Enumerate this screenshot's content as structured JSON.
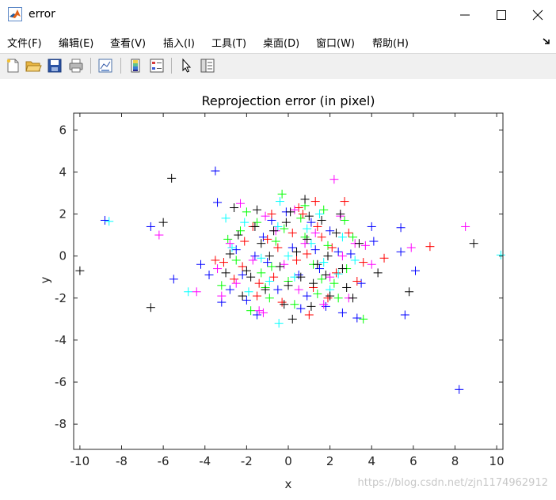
{
  "window": {
    "title": "error",
    "accent": "#0072bd"
  },
  "menu": {
    "items": [
      "文件(F)",
      "编辑(E)",
      "查看(V)",
      "插入(I)",
      "工具(T)",
      "桌面(D)",
      "窗口(W)",
      "帮助(H)"
    ]
  },
  "toolbar": {
    "buttons": [
      "new-figure-icon",
      "open-file-icon",
      "save-icon",
      "print-icon",
      "link-plot-icon",
      "colorbar-icon",
      "legend-icon",
      "pointer-icon",
      "property-inspector-icon"
    ]
  },
  "watermark": "https://blog.csdn.net/zjn1174962912",
  "chart_data": {
    "type": "scatter",
    "title": "Reprojection error (in pixel)",
    "xlabel": "x",
    "ylabel": "y",
    "xlim": [
      -10.3,
      10.3
    ],
    "ylim": [
      -9.2,
      6.8
    ],
    "xticks": [
      -10,
      -8,
      -6,
      -4,
      -2,
      0,
      2,
      4,
      6,
      8,
      10
    ],
    "yticks": [
      -8,
      -6,
      -4,
      -2,
      0,
      2,
      4,
      6
    ],
    "marker": "+",
    "grid": false,
    "colors": [
      "#0000ff",
      "#00ff00",
      "#ff0000",
      "#00ffff",
      "#ff00ff",
      "#000000"
    ],
    "series": [
      {
        "color": "#0000ff",
        "points": [
          [
            -8.8,
            1.7
          ],
          [
            -6.6,
            1.4
          ],
          [
            -3.5,
            4.05
          ],
          [
            -3.4,
            2.55
          ],
          [
            -5.5,
            -1.1
          ],
          [
            -4.2,
            -0.4
          ],
          [
            -3.2,
            -2.2
          ],
          [
            -2.0,
            -2.1
          ],
          [
            -1.5,
            -2.8
          ],
          [
            -0.5,
            -1.6
          ],
          [
            0.6,
            -2.5
          ],
          [
            1.8,
            -2.4
          ],
          [
            2.6,
            -2.7
          ],
          [
            3.3,
            -2.95
          ],
          [
            3.5,
            -1.3
          ],
          [
            4.0,
            1.4
          ],
          [
            4.1,
            0.7
          ],
          [
            5.4,
            1.35
          ],
          [
            5.4,
            0.2
          ],
          [
            6.1,
            -0.7
          ],
          [
            5.6,
            -2.8
          ],
          [
            8.2,
            -6.35
          ],
          [
            -2.5,
            0.3
          ],
          [
            -1.2,
            0.9
          ],
          [
            0.2,
            0.4
          ],
          [
            1.5,
            -0.6
          ],
          [
            2.4,
            0.2
          ],
          [
            -0.8,
            1.7
          ],
          [
            1.1,
            1.6
          ],
          [
            -2.2,
            -0.9
          ],
          [
            0.5,
            -0.9
          ],
          [
            2.0,
            1.2
          ],
          [
            -1.6,
            0.0
          ],
          [
            3.0,
            0.1
          ],
          [
            -3.8,
            -0.9
          ],
          [
            -0.1,
            2.1
          ],
          [
            1.3,
            0.3
          ],
          [
            -2.8,
            -1.6
          ],
          [
            0.9,
            -1.9
          ],
          [
            -1.0,
            -0.3
          ]
        ]
      },
      {
        "color": "#00ff00",
        "points": [
          [
            -2.0,
            2.1
          ],
          [
            -1.5,
            1.6
          ],
          [
            -0.3,
            2.95
          ],
          [
            0.8,
            2.4
          ],
          [
            1.7,
            2.2
          ],
          [
            2.7,
            1.7
          ],
          [
            -2.5,
            -0.2
          ],
          [
            -1.8,
            -2.6
          ],
          [
            -0.9,
            -2.0
          ],
          [
            0.3,
            -2.3
          ],
          [
            1.4,
            -1.8
          ],
          [
            2.2,
            -1.3
          ],
          [
            3.6,
            -3.0
          ],
          [
            -3.2,
            -1.4
          ],
          [
            -0.6,
            0.7
          ],
          [
            0.8,
            0.9
          ],
          [
            1.9,
            0.5
          ],
          [
            -1.3,
            -0.8
          ],
          [
            2.8,
            -0.6
          ],
          [
            0.0,
            -1.2
          ],
          [
            -2.9,
            0.8
          ],
          [
            1.2,
            -0.4
          ],
          [
            -0.2,
            1.3
          ],
          [
            2.4,
            -2.0
          ],
          [
            -1.1,
            -1.5
          ],
          [
            0.6,
            1.8
          ],
          [
            -2.3,
            1.2
          ],
          [
            1.6,
            -1.1
          ],
          [
            -0.8,
            -0.5
          ],
          [
            3.1,
            0.9
          ]
        ]
      },
      {
        "color": "#ff0000",
        "points": [
          [
            2.7,
            2.6
          ],
          [
            1.3,
            2.6
          ],
          [
            -0.8,
            2.0
          ],
          [
            0.7,
            2.0
          ],
          [
            3.6,
            -0.3
          ],
          [
            4.6,
            -0.1
          ],
          [
            6.8,
            0.45
          ],
          [
            1.0,
            -2.8
          ],
          [
            -1.4,
            -1.3
          ],
          [
            -3.1,
            -0.3
          ],
          [
            -2.1,
            0.7
          ],
          [
            -0.5,
            0.4
          ],
          [
            0.4,
            -0.2
          ],
          [
            1.6,
            0.9
          ],
          [
            2.3,
            -0.8
          ],
          [
            -1.7,
            1.4
          ],
          [
            0.2,
            1.1
          ],
          [
            1.2,
            -1.5
          ],
          [
            -2.6,
            -1.1
          ],
          [
            2.9,
            1.1
          ],
          [
            -0.3,
            -2.2
          ],
          [
            1.9,
            -2.0
          ],
          [
            -1.0,
            0.8
          ],
          [
            0.9,
            0.1
          ],
          [
            3.3,
            -1.2
          ],
          [
            -2.2,
            -0.5
          ],
          [
            0.5,
            2.3
          ],
          [
            -0.7,
            -1.0
          ],
          [
            2.1,
            0.4
          ],
          [
            -1.5,
            -1.9
          ],
          [
            1.4,
            1.4
          ],
          [
            -3.5,
            -0.2
          ]
        ]
      },
      {
        "color": "#00ffff",
        "points": [
          [
            -8.6,
            1.65
          ],
          [
            -4.8,
            -1.7
          ],
          [
            -3.0,
            1.8
          ],
          [
            -0.45,
            -3.2
          ],
          [
            10.2,
            0.05
          ],
          [
            2.4,
            -0.85
          ],
          [
            -1.9,
            -1.7
          ],
          [
            0.3,
            -1.0
          ],
          [
            1.1,
            0.6
          ],
          [
            -2.7,
            0.4
          ],
          [
            2.0,
            -1.6
          ],
          [
            -0.5,
            1.4
          ],
          [
            0.9,
            1.3
          ],
          [
            -1.3,
            -0.1
          ],
          [
            1.7,
            -0.3
          ],
          [
            -2.1,
            1.6
          ],
          [
            2.6,
            0.9
          ],
          [
            0.0,
            0.0
          ],
          [
            -0.9,
            -1.2
          ],
          [
            1.5,
            2.0
          ],
          [
            -0.4,
            2.6
          ],
          [
            3.2,
            -0.2
          ]
        ]
      },
      {
        "color": "#ff00ff",
        "points": [
          [
            -6.2,
            1.0
          ],
          [
            -4.4,
            -1.7
          ],
          [
            -2.3,
            2.5
          ],
          [
            2.2,
            3.65
          ],
          [
            2.5,
            1.9
          ],
          [
            3.7,
            0.5
          ],
          [
            4.0,
            -0.4
          ],
          [
            5.9,
            0.4
          ],
          [
            8.5,
            1.4
          ],
          [
            2.9,
            -2.0
          ],
          [
            -1.2,
            -2.7
          ],
          [
            -1.4,
            -2.6
          ],
          [
            -3.2,
            -1.9
          ],
          [
            -3.4,
            -0.6
          ],
          [
            -2.8,
            0.6
          ],
          [
            -1.7,
            -0.2
          ],
          [
            0.5,
            -1.6
          ],
          [
            1.3,
            1.1
          ],
          [
            -0.6,
            1.2
          ],
          [
            2.0,
            -1.0
          ],
          [
            0.8,
            0.6
          ],
          [
            -2.5,
            -1.3
          ],
          [
            1.7,
            -2.3
          ],
          [
            -0.2,
            -0.4
          ],
          [
            2.6,
            0.0
          ],
          [
            -1.1,
            1.9
          ],
          [
            0.3,
            2.2
          ],
          [
            3.2,
            0.6
          ]
        ]
      },
      {
        "color": "#000000",
        "points": [
          [
            -5.6,
            3.7
          ],
          [
            -6.0,
            1.6
          ],
          [
            -6.6,
            -2.45
          ],
          [
            -10.0,
            -0.7
          ],
          [
            8.9,
            0.6
          ],
          [
            5.8,
            -1.7
          ],
          [
            4.3,
            -0.8
          ],
          [
            3.4,
            0.6
          ],
          [
            2.6,
            -0.6
          ],
          [
            1.8,
            -0.9
          ],
          [
            1.1,
            -2.4
          ],
          [
            0.2,
            -3.0
          ],
          [
            -0.2,
            -2.3
          ],
          [
            -1.1,
            -1.6
          ],
          [
            -2.0,
            -0.7
          ],
          [
            -2.8,
            0.1
          ],
          [
            -2.6,
            2.3
          ],
          [
            -1.6,
            1.4
          ],
          [
            -0.7,
            1.2
          ],
          [
            0.1,
            2.1
          ],
          [
            0.9,
            0.8
          ],
          [
            1.6,
            1.7
          ],
          [
            2.3,
            1.1
          ],
          [
            -0.4,
            -0.5
          ],
          [
            0.6,
            -1.0
          ],
          [
            1.4,
            -0.4
          ],
          [
            -1.3,
            0.6
          ],
          [
            2.8,
            -1.5
          ],
          [
            -2.2,
            -1.9
          ],
          [
            0.4,
            0.2
          ],
          [
            -0.9,
            0.0
          ],
          [
            1.9,
            0.0
          ],
          [
            3.1,
            -2.0
          ],
          [
            -1.8,
            -1.0
          ],
          [
            0.8,
            2.7
          ],
          [
            -3.0,
            -0.8
          ],
          [
            2.0,
            -1.9
          ],
          [
            -0.1,
            1.6
          ],
          [
            1.2,
            -1.3
          ],
          [
            -2.4,
            1.0
          ],
          [
            0.0,
            -1.4
          ],
          [
            2.5,
            2.0
          ],
          [
            -1.5,
            2.2
          ],
          [
            1.0,
            1.9
          ]
        ]
      }
    ]
  }
}
